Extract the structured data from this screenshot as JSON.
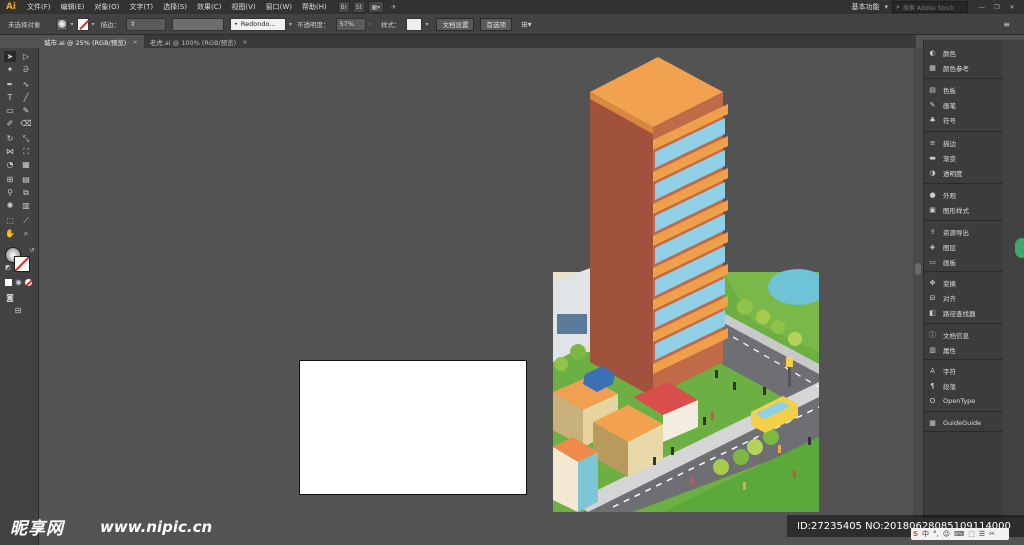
{
  "app": {
    "logo": "Ai",
    "workspace": "基本功能",
    "stock_search_placeholder": "搜索 Adobe Stock"
  },
  "menu": [
    "文件(F)",
    "编辑(E)",
    "对象(O)",
    "文字(T)",
    "选择(S)",
    "效果(C)",
    "视图(V)",
    "窗口(W)",
    "帮助(H)"
  ],
  "menu_icons": [
    "Br",
    "St"
  ],
  "control": {
    "selection_label": "未选择对象",
    "stroke_label": "描边：",
    "brush_value": "Redondo...",
    "opacity_label": "不透明度：",
    "opacity_value": "57%",
    "style_label": "样式：",
    "doc_setup": "文档设置",
    "preferences": "首选项"
  },
  "tabs": [
    {
      "label": "城市.ai @ 25% (RGB/预览)",
      "close": "×"
    },
    {
      "label": "老虎.ai @ 100% (RGB/预览)",
      "close": "×"
    }
  ],
  "panels": [
    {
      "icon": "color-wheel-icon",
      "glyph": "◐",
      "label": "颜色"
    },
    {
      "icon": "color-guide-icon",
      "glyph": "▦",
      "label": "颜色参考"
    },
    {
      "icon": "swatches-icon",
      "glyph": "▤",
      "label": "色板"
    },
    {
      "icon": "brush-icon",
      "glyph": "✎",
      "label": "画笔"
    },
    {
      "icon": "symbol-icon",
      "glyph": "♣",
      "label": "符号"
    },
    {
      "icon": "stroke-icon",
      "glyph": "≡",
      "label": "描边"
    },
    {
      "icon": "gradient-icon",
      "glyph": "▬",
      "label": "渐变"
    },
    {
      "icon": "transparency-icon",
      "glyph": "◑",
      "label": "透明度"
    },
    {
      "icon": "appearance-icon",
      "glyph": "●",
      "label": "外观"
    },
    {
      "icon": "graphic-styles-icon",
      "glyph": "▣",
      "label": "图形样式"
    },
    {
      "icon": "asset-export-icon",
      "glyph": "⇪",
      "label": "资源导出"
    },
    {
      "icon": "layers-icon",
      "glyph": "◈",
      "label": "图层"
    },
    {
      "icon": "artboards-icon",
      "glyph": "▭",
      "label": "画板"
    },
    {
      "icon": "transform-icon",
      "glyph": "✥",
      "label": "变换"
    },
    {
      "icon": "align-icon",
      "glyph": "⊟",
      "label": "对齐"
    },
    {
      "icon": "pathfinder-icon",
      "glyph": "◧",
      "label": "路径查找器"
    },
    {
      "icon": "doc-info-icon",
      "glyph": "ⓘ",
      "label": "文档信息"
    },
    {
      "icon": "attributes-icon",
      "glyph": "▥",
      "label": "属性"
    },
    {
      "icon": "character-icon",
      "glyph": "A",
      "label": "字符"
    },
    {
      "icon": "paragraph-icon",
      "glyph": "¶",
      "label": "段落"
    },
    {
      "icon": "opentype-icon",
      "glyph": "O",
      "label": "OpenType"
    },
    {
      "icon": "guideguide-icon",
      "glyph": "▦",
      "label": "GuideGuide"
    }
  ],
  "watermark": {
    "logo": "昵享网",
    "url": "www.nipic.cn",
    "id": "ID:27235405 NO:20180628085109114000"
  },
  "ime": [
    "S",
    "中",
    "°,",
    "☺",
    "⌨",
    "⬚",
    "☰",
    "✂"
  ],
  "colors": {
    "accent": "#f7a21b",
    "building": "#a0523d",
    "roof": "#f2a24e",
    "grass": "#6cb043",
    "road": "#6f6f73"
  }
}
